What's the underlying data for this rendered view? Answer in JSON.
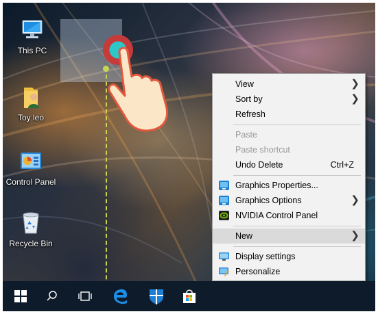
{
  "desktop": {
    "icons": [
      {
        "label": "This PC",
        "icon": "this-pc-icon"
      },
      {
        "label": "Toy leo",
        "icon": "user-folder-icon"
      },
      {
        "label": "Control Panel",
        "icon": "control-panel-icon"
      },
      {
        "label": "Recycle Bin",
        "icon": "recycle-bin-icon"
      }
    ]
  },
  "context_menu": {
    "items": [
      {
        "label": "View",
        "submenu": true
      },
      {
        "label": "Sort by",
        "submenu": true
      },
      {
        "label": "Refresh"
      },
      {
        "label": "Paste",
        "disabled": true
      },
      {
        "label": "Paste shortcut",
        "disabled": true
      },
      {
        "label": "Undo Delete",
        "shortcut": "Ctrl+Z"
      },
      {
        "label": "Graphics Properties...",
        "icon": "intel-graphics-icon"
      },
      {
        "label": "Graphics Options",
        "icon": "intel-graphics-icon",
        "submenu": true
      },
      {
        "label": "NVIDIA Control Panel",
        "icon": "nvidia-icon"
      },
      {
        "label": "New",
        "submenu": true,
        "highlighted": true
      },
      {
        "label": "Display settings",
        "icon": "display-icon"
      },
      {
        "label": "Personalize",
        "icon": "personalize-icon"
      }
    ]
  },
  "taskbar": {
    "items": [
      {
        "name": "start-button",
        "icon": "windows-logo-icon"
      },
      {
        "name": "search-button",
        "icon": "search-icon"
      },
      {
        "name": "task-view-button",
        "icon": "task-view-icon"
      },
      {
        "name": "edge-button",
        "icon": "edge-icon"
      },
      {
        "name": "defender-button",
        "icon": "shield-icon"
      },
      {
        "name": "store-button",
        "icon": "store-icon"
      }
    ]
  },
  "colors": {
    "taskbar": "#0d1b2a",
    "menu_bg": "#f2f2f2",
    "menu_highlight": "#dadada",
    "touch_ring_outer": "#c63a3a",
    "touch_ring_inner": "#2fc6c8",
    "guide_line": "#c8d455"
  }
}
